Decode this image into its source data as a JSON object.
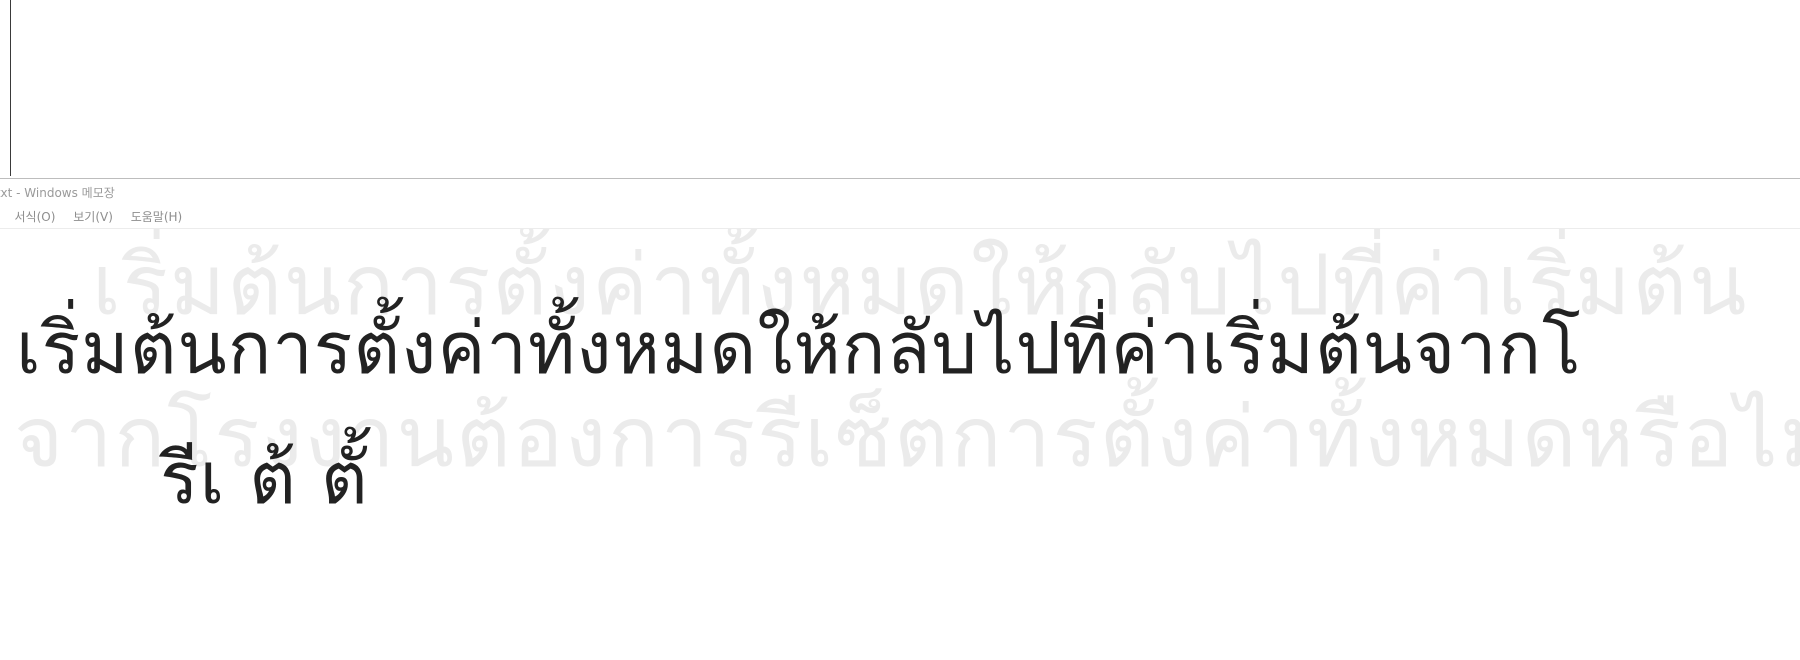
{
  "window": {
    "title": ".txt - Windows 메모장"
  },
  "menu": {
    "items": [
      ")",
      "서식(O)",
      "보기(V)",
      "도움말(H)"
    ]
  },
  "editor": {
    "ghost_line_1": "เริ่มต้นการตั้งค่าทั้งหมดให้กลับไปที่ค่าเริ่มต้น",
    "ghost_line_2": "จากโรงงานต้องการรีเซ็ตการตั้งค่าทั้งหมดหรือไม่",
    "line_1": "เริ่มต้นการตั้งค่าทั้งหมดให้กลับไปที่ค่าเริ่มต้นจากโ",
    "line_2": "รีเ ต้ ตั้"
  }
}
